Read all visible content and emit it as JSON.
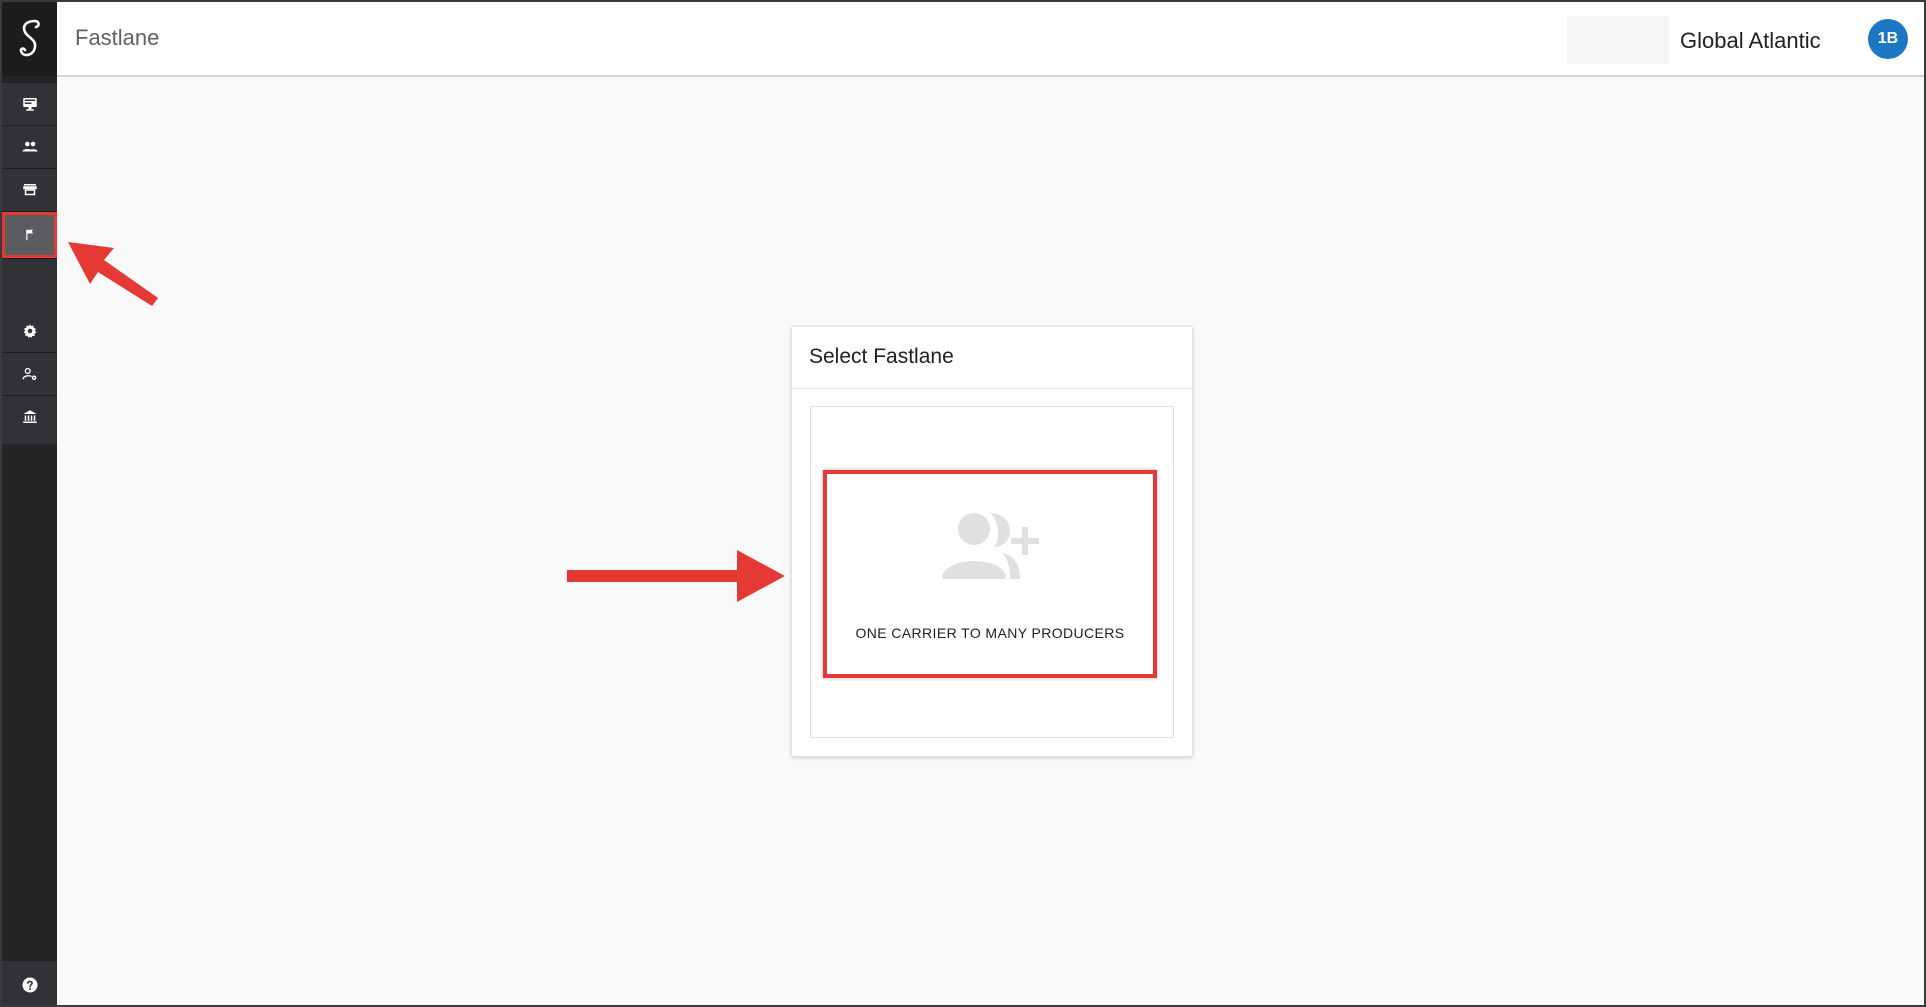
{
  "header": {
    "app_title": "Fastlane",
    "org_name": "Global Atlantic",
    "avatar_initials": "1B"
  },
  "sidebar": {
    "logo_icon": "scroll-s-logo",
    "items": [
      {
        "icon": "monitor-icon",
        "active": false
      },
      {
        "icon": "people-icon",
        "active": false
      },
      {
        "icon": "store-icon",
        "active": false
      },
      {
        "icon": "flag-icon",
        "active": true
      },
      {
        "icon": "gear-icon",
        "active": false
      },
      {
        "icon": "user-settings-icon",
        "active": false
      },
      {
        "icon": "bank-icon",
        "active": false
      }
    ],
    "help_icon": "help-icon"
  },
  "card": {
    "title": "Select Fastlane",
    "option": {
      "label": "ONE CARRIER TO MANY PRODUCERS",
      "icon": "group-add-icon"
    }
  },
  "colors": {
    "accent": "#1a78c2",
    "annotation": "#e53935",
    "sidebar": "#222426"
  }
}
